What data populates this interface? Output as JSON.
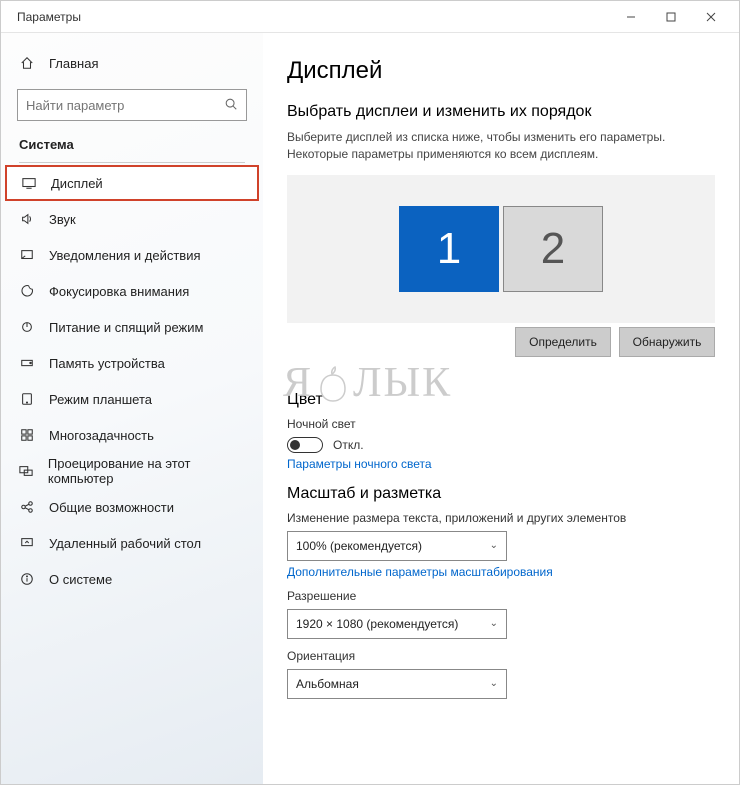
{
  "window": {
    "title": "Параметры"
  },
  "sidebar": {
    "home_label": "Главная",
    "search_placeholder": "Найти параметр",
    "group_label": "Система",
    "items": [
      {
        "label": "Дисплей"
      },
      {
        "label": "Звук"
      },
      {
        "label": "Уведомления и действия"
      },
      {
        "label": "Фокусировка внимания"
      },
      {
        "label": "Питание и спящий режим"
      },
      {
        "label": "Память устройства"
      },
      {
        "label": "Режим планшета"
      },
      {
        "label": "Многозадачность"
      },
      {
        "label": "Проецирование на этот компьютер"
      },
      {
        "label": "Общие возможности"
      },
      {
        "label": "Удаленный рабочий стол"
      },
      {
        "label": "О системе"
      }
    ]
  },
  "content": {
    "title": "Дисплей",
    "arrange_heading": "Выбрать дисплеи и изменить их порядок",
    "arrange_desc": "Выберите дисплей из списка ниже, чтобы изменить его параметры. Некоторые параметры применяются ко всем дисплеям.",
    "monitor1": "1",
    "monitor2": "2",
    "identify_btn": "Определить",
    "detect_btn": "Обнаружить",
    "watermark": "ЯБЛЫК",
    "color_heading": "Цвет",
    "nightlight_label": "Ночной свет",
    "nightlight_state": "Откл.",
    "nightlight_link": "Параметры ночного света",
    "scale_heading": "Масштаб и разметка",
    "scale_label": "Изменение размера текста, приложений и других элементов",
    "scale_value": "100% (рекомендуется)",
    "scale_link": "Дополнительные параметры масштабирования",
    "resolution_label": "Разрешение",
    "resolution_value": "1920 × 1080 (рекомендуется)",
    "orientation_label": "Ориентация",
    "orientation_value": "Альбомная"
  }
}
